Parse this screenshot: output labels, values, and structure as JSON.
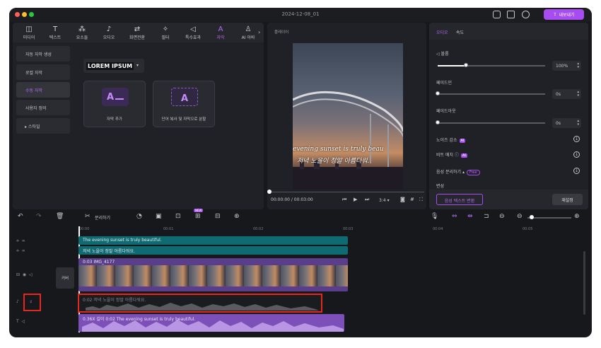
{
  "window": {
    "title": "2024-12-08_01",
    "export_label": "내보내기"
  },
  "toolbar": {
    "tools": [
      {
        "label": "미디어",
        "icon": "media-icon"
      },
      {
        "label": "텍스트",
        "icon": "text-icon"
      },
      {
        "label": "요소들",
        "icon": "elements-icon"
      },
      {
        "label": "오디오",
        "icon": "audio-icon"
      },
      {
        "label": "화면전환",
        "icon": "transition-icon"
      },
      {
        "label": "필터",
        "icon": "filter-icon"
      },
      {
        "label": "특수효과",
        "icon": "effects-icon"
      },
      {
        "label": "자막",
        "icon": "captions-icon",
        "active": true
      },
      {
        "label": "AI 아바",
        "icon": "ai-avatar-icon"
      }
    ]
  },
  "sidebar": {
    "items": [
      {
        "label": "자동 자막 생성"
      },
      {
        "label": "로컬 자막"
      },
      {
        "label": "수동 자막",
        "active": true
      },
      {
        "label": "사용자 정의"
      },
      {
        "label": "스타일"
      }
    ]
  },
  "captions": {
    "style_preset": "LOREM IPSUM",
    "cards": [
      {
        "label": "자막 추가"
      },
      {
        "label": "단어 복사 및 자막으로 분할"
      }
    ]
  },
  "player": {
    "label": "플레이어",
    "subtitle_en": "evening sunset is truly beau",
    "subtitle_ko": "저녁 노을이 정말 아름다워.",
    "current_time": "00:00:00",
    "total_time": "00:03:00",
    "ratio": "3:4"
  },
  "properties": {
    "tabs": [
      {
        "label": "오디오",
        "active": true
      },
      {
        "label": "속도"
      }
    ],
    "volume": {
      "label": "볼륨",
      "value": "100%",
      "level": 0.26
    },
    "fade_in": {
      "label": "페이드인",
      "value": "0s"
    },
    "fade_out": {
      "label": "페이드아웃",
      "value": "0s"
    },
    "noise_reduction": {
      "label": "노이즈 감소",
      "badge": "AI"
    },
    "beat_match": {
      "label": "비트 매치",
      "badge": "AI"
    },
    "voice_separation": {
      "label": "음성 분리하기",
      "badge": "Free"
    },
    "voice_change": {
      "label": "변성"
    },
    "to_text_button": "음성 텍스트 변환",
    "reset_button": "재설정"
  },
  "timeline_toolbar": {
    "split_label": "분리하기",
    "new_badge": "NEW"
  },
  "ruler": {
    "ticks": [
      "00:00",
      "00:01",
      "00:02",
      "00:03",
      "00:04",
      "00:05"
    ]
  },
  "tracks": {
    "cover_label": "커버",
    "subtitle_en_clip": "The evening sunset is truly beautiful.",
    "subtitle_ko_clip": "저녁 노을이 정말 아름다워요.",
    "video_clip": "0:03 IMG_4177",
    "audio_ko_clip": "0:02 저녁 노을이 정말 아름다워요.",
    "audio_en_clip": "0.36X 길이 0:02 The evening sunset is truly beautiful."
  }
}
